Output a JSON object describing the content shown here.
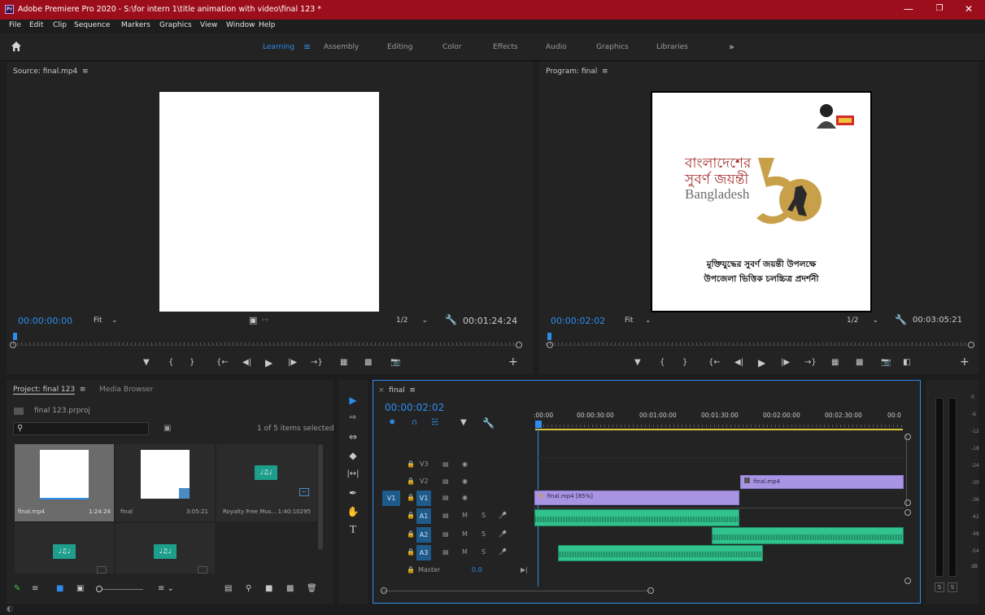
{
  "window": {
    "title": "Adobe Premiere Pro 2020 - S:\\for intern 1\\title animation with video\\final 123 *",
    "logo": "Pr",
    "minimize_icon": "minimize-icon",
    "restore_icon": "restore-icon",
    "close_icon": "close-icon"
  },
  "menu": [
    "File",
    "Edit",
    "Clip",
    "Sequence",
    "Markers",
    "Graphics",
    "View",
    "Window",
    "Help"
  ],
  "workspaces": {
    "items": [
      "Learning",
      "Assembly",
      "Editing",
      "Color",
      "Effects",
      "Audio",
      "Graphics",
      "Libraries"
    ],
    "active": "Learning",
    "overflow": "»"
  },
  "source_monitor": {
    "title": "Source: final.mp4",
    "timecode": "00:00:00:00",
    "fit": "Fit",
    "resolution": "1/2",
    "duration": "00:01:24:24"
  },
  "program_monitor": {
    "title": "Program: final",
    "timecode": "00:00:02:02",
    "fit": "Fit",
    "resolution": "1/2",
    "duration": "00:03:05:21",
    "frame": {
      "line1": "বাংলাদেশের",
      "line2": "সুবর্ণ জয়ন্তী",
      "line3": "Bangladesh",
      "number": "50",
      "caption1": "মুক্তিযুদ্ধের সুবর্ণ জয়ন্তী উপলক্ষে",
      "caption2": "উপজেলা ভিত্তিক চলচ্চিত্র প্রদর্শনী"
    }
  },
  "project_panel": {
    "tab_project": "Project: final 123",
    "tab_media": "Media Browser",
    "file": "final 123.prproj",
    "selection_info": "1 of 5 items selected",
    "items": [
      {
        "name": "final.mp4",
        "duration": "1:24:24"
      },
      {
        "name": "final",
        "duration": "3:05:21"
      },
      {
        "name": "Royalty Free Mus...",
        "duration": "1:40:10295"
      },
      {
        "name": "",
        "duration": ""
      },
      {
        "name": "",
        "duration": ""
      }
    ]
  },
  "timeline": {
    "sequence": "final",
    "timecode": "00:00:02:02",
    "ruler": [
      ":00:00",
      "00:00:30:00",
      "00:01:00:00",
      "00:01:30:00",
      "00:02:00:00",
      "00:02:30:00",
      "00:0"
    ],
    "tracks": {
      "v3": "V3",
      "v2": "V2",
      "v1": "V1",
      "v1_source": "V1",
      "a1": "A1",
      "a2": "A2",
      "a3": "A3",
      "master": "Master",
      "master_value": "0.0",
      "mute": "M",
      "solo": "S"
    },
    "clips": {
      "v2_clip": "final.mp4",
      "v1_clip": "final.mp4 [85%]",
      "fx": "fx"
    }
  },
  "meters": {
    "scale": [
      "0",
      "-6",
      "-12",
      "-18",
      "-24",
      "-30",
      "-36",
      "-42",
      "-48",
      "-54",
      "dB"
    ],
    "solo_left": "S",
    "solo_right": "S"
  },
  "colors": {
    "accent": "#2d8ceb",
    "titlebar": "#9c0e1b",
    "video_clip": "#a994e3",
    "audio_clip": "#32c28f",
    "gold": "#c9a04a"
  }
}
